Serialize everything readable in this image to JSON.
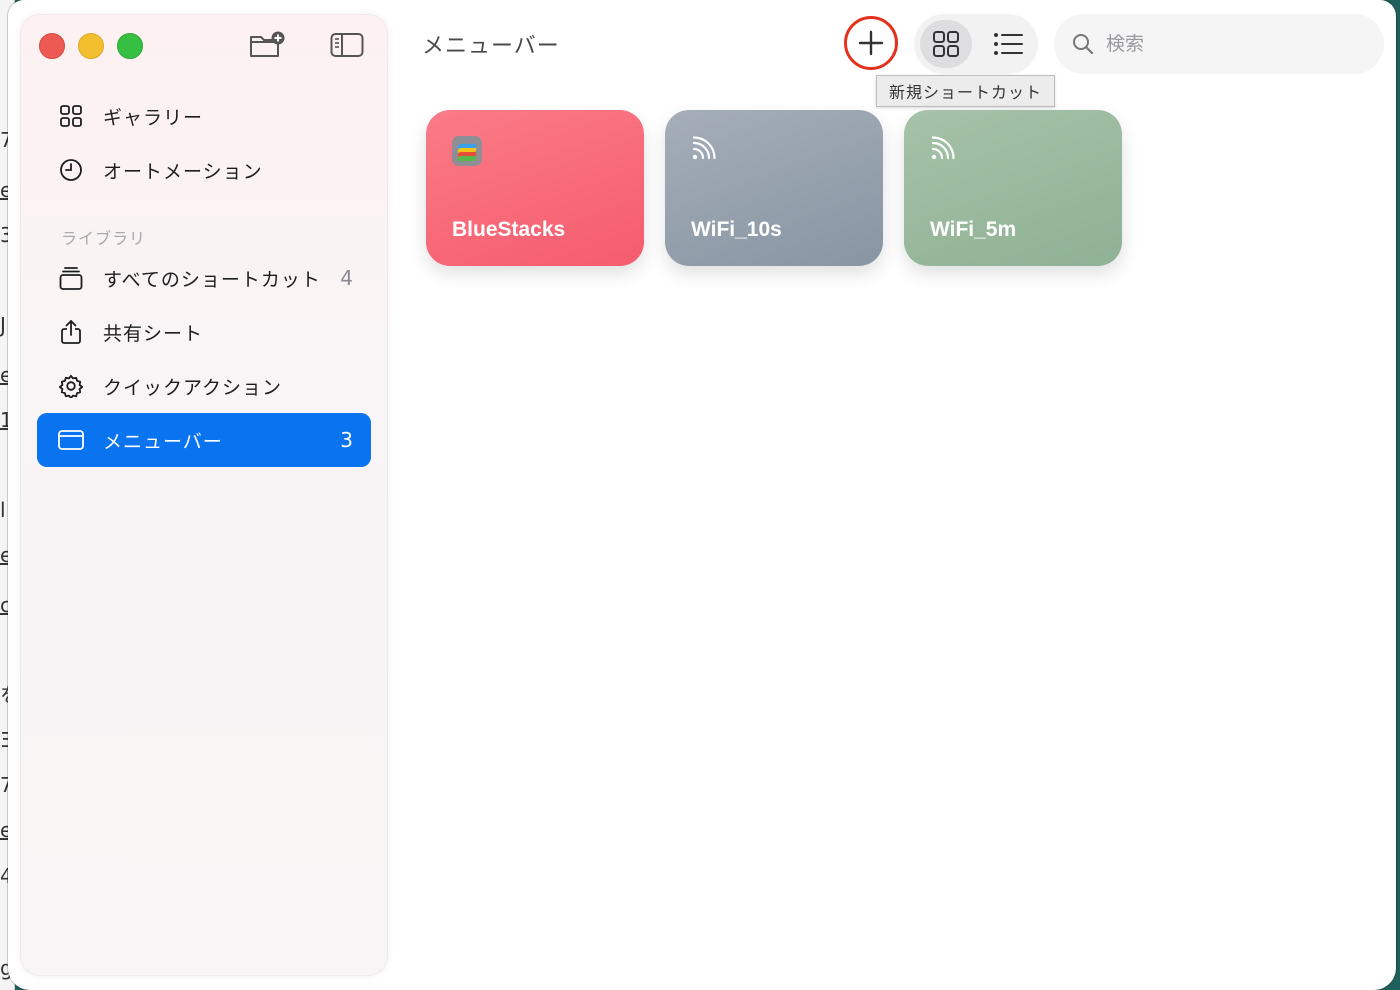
{
  "window": {
    "traffic_lights": [
      "close",
      "minimize",
      "zoom"
    ]
  },
  "sidebar": {
    "top_items": [
      {
        "label": "ギャラリー",
        "icon": "grid-icon"
      },
      {
        "label": "オートメーション",
        "icon": "clock-icon"
      }
    ],
    "section_label": "ライブラリ",
    "library_items": [
      {
        "label": "すべてのショートカット",
        "count": "4",
        "icon": "stack-icon"
      },
      {
        "label": "共有シート",
        "count": "",
        "icon": "share-icon"
      },
      {
        "label": "クイックアクション",
        "count": "",
        "icon": "gear-icon"
      },
      {
        "label": "メニューバー",
        "count": "3",
        "icon": "menubar-icon",
        "selected": true
      }
    ]
  },
  "main": {
    "title": "メニューバー",
    "tooltip": "新規ショートカット",
    "search": {
      "placeholder": "検索",
      "value": ""
    },
    "view_mode": "grid",
    "shortcuts": [
      {
        "title": "BlueStacks",
        "color": "#f8697a",
        "icon": "bluestacks-app-icon"
      },
      {
        "title": "WiFi_10s",
        "color": "#96a1ae",
        "icon": "wifi-signal-icon"
      },
      {
        "title": "WiFi_5m",
        "color": "#9aba9e",
        "icon": "wifi-signal-icon"
      }
    ]
  },
  "accent_colors": {
    "selection": "#0a74f0",
    "highlight_ring": "#e2321d"
  }
}
